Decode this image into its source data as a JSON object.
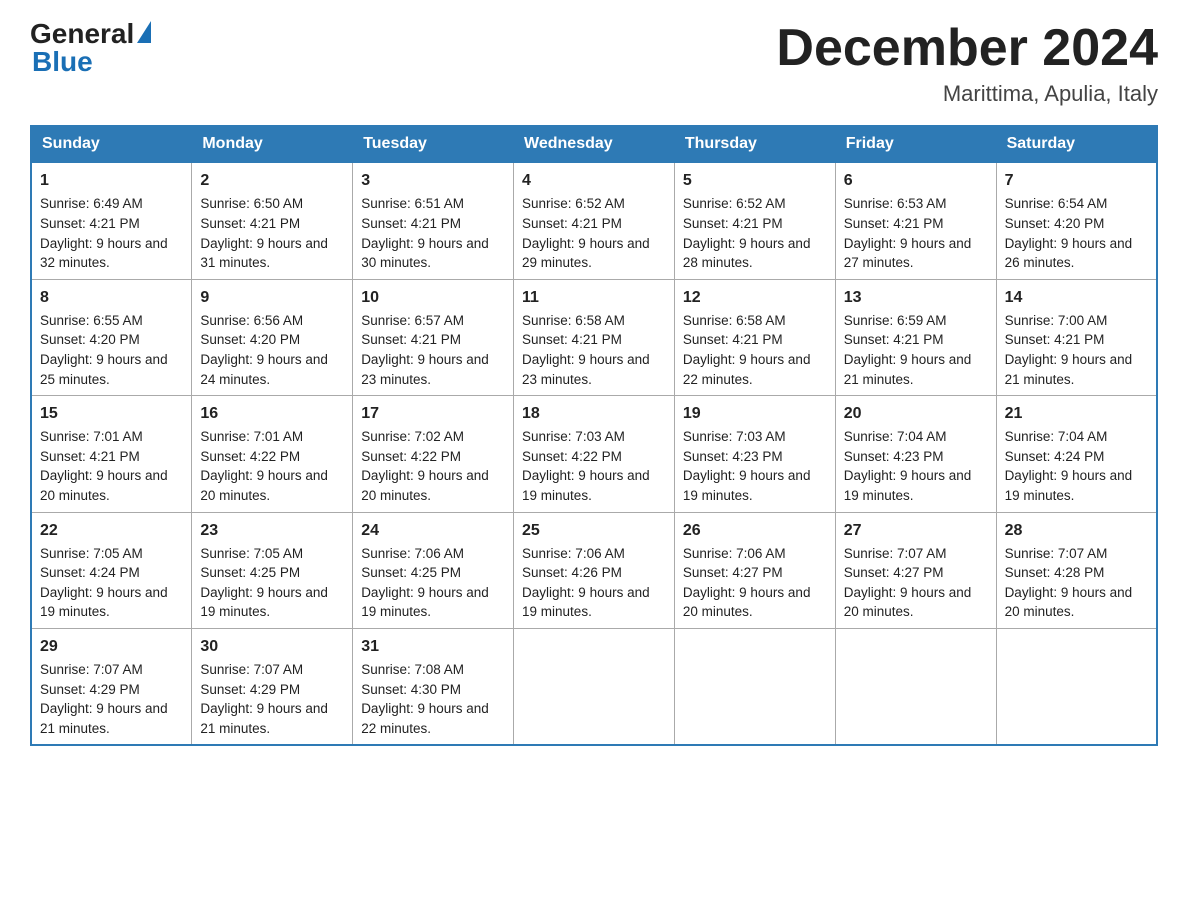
{
  "header": {
    "logo_general": "General",
    "logo_blue": "Blue",
    "month_year": "December 2024",
    "location": "Marittima, Apulia, Italy"
  },
  "days_of_week": [
    "Sunday",
    "Monday",
    "Tuesday",
    "Wednesday",
    "Thursday",
    "Friday",
    "Saturday"
  ],
  "weeks": [
    [
      {
        "day": "1",
        "sunrise": "Sunrise: 6:49 AM",
        "sunset": "Sunset: 4:21 PM",
        "daylight": "Daylight: 9 hours and 32 minutes."
      },
      {
        "day": "2",
        "sunrise": "Sunrise: 6:50 AM",
        "sunset": "Sunset: 4:21 PM",
        "daylight": "Daylight: 9 hours and 31 minutes."
      },
      {
        "day": "3",
        "sunrise": "Sunrise: 6:51 AM",
        "sunset": "Sunset: 4:21 PM",
        "daylight": "Daylight: 9 hours and 30 minutes."
      },
      {
        "day": "4",
        "sunrise": "Sunrise: 6:52 AM",
        "sunset": "Sunset: 4:21 PM",
        "daylight": "Daylight: 9 hours and 29 minutes."
      },
      {
        "day": "5",
        "sunrise": "Sunrise: 6:52 AM",
        "sunset": "Sunset: 4:21 PM",
        "daylight": "Daylight: 9 hours and 28 minutes."
      },
      {
        "day": "6",
        "sunrise": "Sunrise: 6:53 AM",
        "sunset": "Sunset: 4:21 PM",
        "daylight": "Daylight: 9 hours and 27 minutes."
      },
      {
        "day": "7",
        "sunrise": "Sunrise: 6:54 AM",
        "sunset": "Sunset: 4:20 PM",
        "daylight": "Daylight: 9 hours and 26 minutes."
      }
    ],
    [
      {
        "day": "8",
        "sunrise": "Sunrise: 6:55 AM",
        "sunset": "Sunset: 4:20 PM",
        "daylight": "Daylight: 9 hours and 25 minutes."
      },
      {
        "day": "9",
        "sunrise": "Sunrise: 6:56 AM",
        "sunset": "Sunset: 4:20 PM",
        "daylight": "Daylight: 9 hours and 24 minutes."
      },
      {
        "day": "10",
        "sunrise": "Sunrise: 6:57 AM",
        "sunset": "Sunset: 4:21 PM",
        "daylight": "Daylight: 9 hours and 23 minutes."
      },
      {
        "day": "11",
        "sunrise": "Sunrise: 6:58 AM",
        "sunset": "Sunset: 4:21 PM",
        "daylight": "Daylight: 9 hours and 23 minutes."
      },
      {
        "day": "12",
        "sunrise": "Sunrise: 6:58 AM",
        "sunset": "Sunset: 4:21 PM",
        "daylight": "Daylight: 9 hours and 22 minutes."
      },
      {
        "day": "13",
        "sunrise": "Sunrise: 6:59 AM",
        "sunset": "Sunset: 4:21 PM",
        "daylight": "Daylight: 9 hours and 21 minutes."
      },
      {
        "day": "14",
        "sunrise": "Sunrise: 7:00 AM",
        "sunset": "Sunset: 4:21 PM",
        "daylight": "Daylight: 9 hours and 21 minutes."
      }
    ],
    [
      {
        "day": "15",
        "sunrise": "Sunrise: 7:01 AM",
        "sunset": "Sunset: 4:21 PM",
        "daylight": "Daylight: 9 hours and 20 minutes."
      },
      {
        "day": "16",
        "sunrise": "Sunrise: 7:01 AM",
        "sunset": "Sunset: 4:22 PM",
        "daylight": "Daylight: 9 hours and 20 minutes."
      },
      {
        "day": "17",
        "sunrise": "Sunrise: 7:02 AM",
        "sunset": "Sunset: 4:22 PM",
        "daylight": "Daylight: 9 hours and 20 minutes."
      },
      {
        "day": "18",
        "sunrise": "Sunrise: 7:03 AM",
        "sunset": "Sunset: 4:22 PM",
        "daylight": "Daylight: 9 hours and 19 minutes."
      },
      {
        "day": "19",
        "sunrise": "Sunrise: 7:03 AM",
        "sunset": "Sunset: 4:23 PM",
        "daylight": "Daylight: 9 hours and 19 minutes."
      },
      {
        "day": "20",
        "sunrise": "Sunrise: 7:04 AM",
        "sunset": "Sunset: 4:23 PM",
        "daylight": "Daylight: 9 hours and 19 minutes."
      },
      {
        "day": "21",
        "sunrise": "Sunrise: 7:04 AM",
        "sunset": "Sunset: 4:24 PM",
        "daylight": "Daylight: 9 hours and 19 minutes."
      }
    ],
    [
      {
        "day": "22",
        "sunrise": "Sunrise: 7:05 AM",
        "sunset": "Sunset: 4:24 PM",
        "daylight": "Daylight: 9 hours and 19 minutes."
      },
      {
        "day": "23",
        "sunrise": "Sunrise: 7:05 AM",
        "sunset": "Sunset: 4:25 PM",
        "daylight": "Daylight: 9 hours and 19 minutes."
      },
      {
        "day": "24",
        "sunrise": "Sunrise: 7:06 AM",
        "sunset": "Sunset: 4:25 PM",
        "daylight": "Daylight: 9 hours and 19 minutes."
      },
      {
        "day": "25",
        "sunrise": "Sunrise: 7:06 AM",
        "sunset": "Sunset: 4:26 PM",
        "daylight": "Daylight: 9 hours and 19 minutes."
      },
      {
        "day": "26",
        "sunrise": "Sunrise: 7:06 AM",
        "sunset": "Sunset: 4:27 PM",
        "daylight": "Daylight: 9 hours and 20 minutes."
      },
      {
        "day": "27",
        "sunrise": "Sunrise: 7:07 AM",
        "sunset": "Sunset: 4:27 PM",
        "daylight": "Daylight: 9 hours and 20 minutes."
      },
      {
        "day": "28",
        "sunrise": "Sunrise: 7:07 AM",
        "sunset": "Sunset: 4:28 PM",
        "daylight": "Daylight: 9 hours and 20 minutes."
      }
    ],
    [
      {
        "day": "29",
        "sunrise": "Sunrise: 7:07 AM",
        "sunset": "Sunset: 4:29 PM",
        "daylight": "Daylight: 9 hours and 21 minutes."
      },
      {
        "day": "30",
        "sunrise": "Sunrise: 7:07 AM",
        "sunset": "Sunset: 4:29 PM",
        "daylight": "Daylight: 9 hours and 21 minutes."
      },
      {
        "day": "31",
        "sunrise": "Sunrise: 7:08 AM",
        "sunset": "Sunset: 4:30 PM",
        "daylight": "Daylight: 9 hours and 22 minutes."
      },
      {
        "day": "",
        "sunrise": "",
        "sunset": "",
        "daylight": ""
      },
      {
        "day": "",
        "sunrise": "",
        "sunset": "",
        "daylight": ""
      },
      {
        "day": "",
        "sunrise": "",
        "sunset": "",
        "daylight": ""
      },
      {
        "day": "",
        "sunrise": "",
        "sunset": "",
        "daylight": ""
      }
    ]
  ]
}
